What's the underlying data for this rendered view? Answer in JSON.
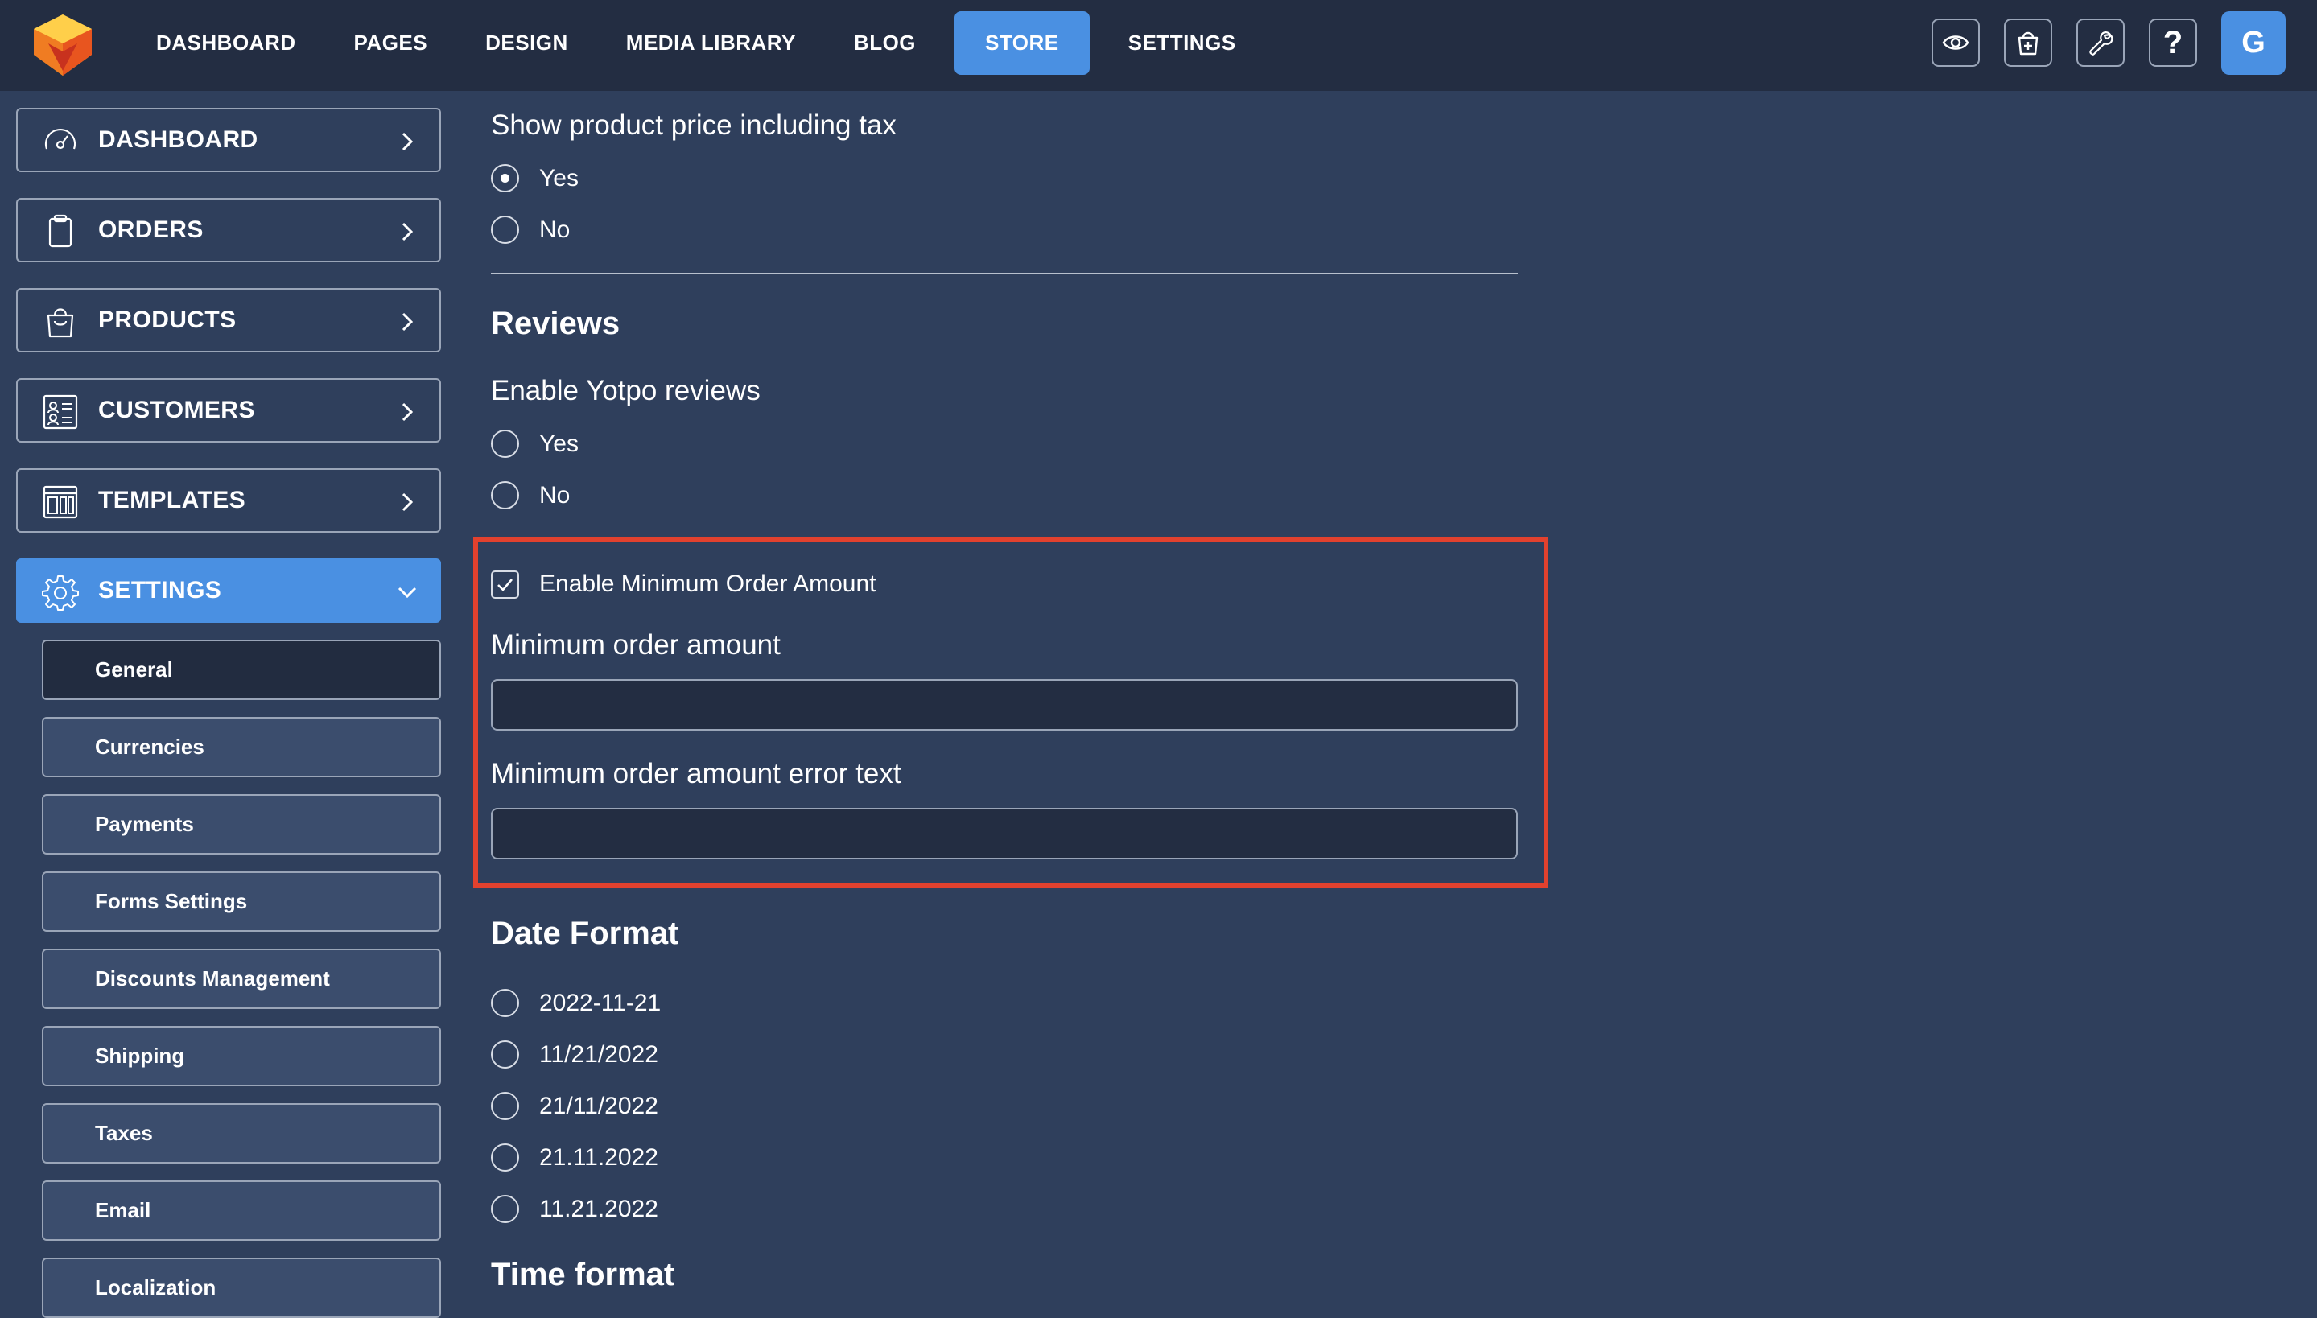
{
  "topbar": {
    "nav": [
      "DASHBOARD",
      "PAGES",
      "DESIGN",
      "MEDIA LIBRARY",
      "BLOG",
      "STORE",
      "SETTINGS"
    ],
    "active_nav": "STORE",
    "tools": [
      "eye-icon",
      "add-to-cart-icon",
      "wrench-icon",
      "help-icon"
    ],
    "help_label": "?",
    "avatar_initial": "G"
  },
  "sidebar": {
    "items": [
      {
        "label": "DASHBOARD",
        "icon": "speedometer-icon"
      },
      {
        "label": "ORDERS",
        "icon": "clipboard-icon"
      },
      {
        "label": "PRODUCTS",
        "icon": "shopping-bag-icon"
      },
      {
        "label": "CUSTOMERS",
        "icon": "contact-card-icon"
      },
      {
        "label": "TEMPLATES",
        "icon": "template-icon"
      },
      {
        "label": "SETTINGS",
        "icon": "gear-icon"
      }
    ],
    "settings_sub": [
      "General",
      "Currencies",
      "Payments",
      "Forms Settings",
      "Discounts Management",
      "Shipping",
      "Taxes",
      "Email",
      "Localization"
    ]
  },
  "main": {
    "price_tax": {
      "label": "Show product price including tax",
      "options": [
        "Yes",
        "No"
      ],
      "selected": "Yes"
    },
    "reviews": {
      "heading": "Reviews",
      "label": "Enable Yotpo reviews",
      "options": [
        "Yes",
        "No"
      ]
    },
    "min_order": {
      "checkbox_label": "Enable Minimum Order Amount",
      "checked": true,
      "amount_label": "Minimum order amount",
      "amount_value": "",
      "error_label": "Minimum order amount error text",
      "error_value": ""
    },
    "date_format": {
      "heading": "Date Format",
      "options": [
        "2022-11-21",
        "11/21/2022",
        "21/11/2022",
        "21.11.2022",
        "11.21.2022"
      ]
    },
    "time_format": {
      "heading": "Time format"
    }
  },
  "colors": {
    "background": "#2f3f5c",
    "topbar": "#232d42",
    "accent": "#4a90e2",
    "highlight": "#e2412e"
  }
}
